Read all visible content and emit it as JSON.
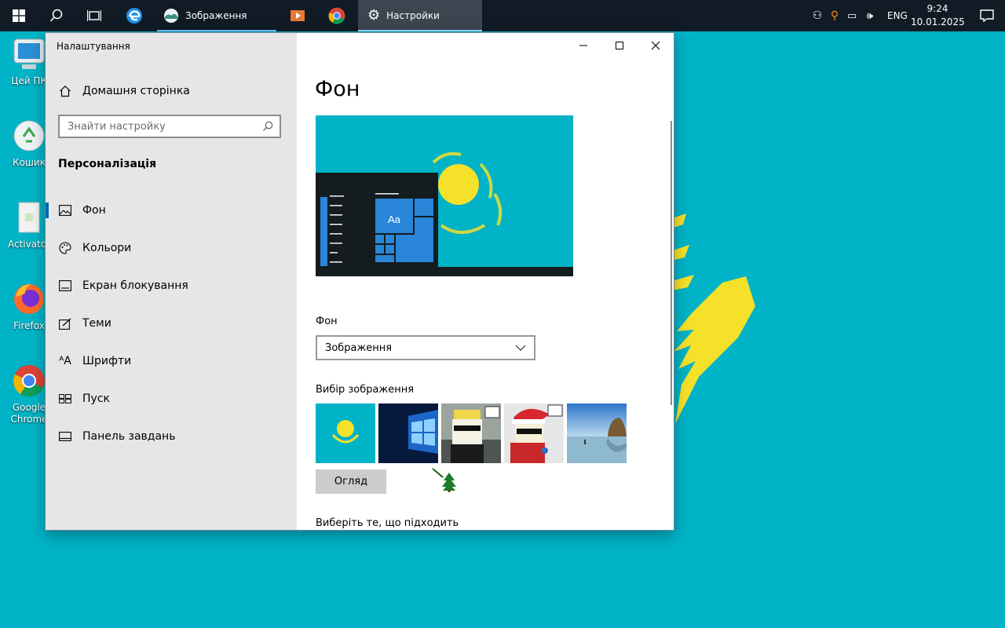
{
  "taskbar": {
    "apps": [
      {
        "name": "photos",
        "label": "Зображення"
      },
      {
        "name": "settings",
        "label": "Настройки"
      }
    ],
    "tray": {
      "language": "ENG",
      "time": "9:24",
      "date": "10.01.2025"
    }
  },
  "desktop": {
    "icons": [
      {
        "label": "Цей ПК",
        "icon": "this-pc-icon"
      },
      {
        "label": "Кошик",
        "icon": "recycle-bin-icon"
      },
      {
        "label": "Activator",
        "icon": "folder-icon"
      },
      {
        "label": "Firefox",
        "icon": "firefox-icon"
      },
      {
        "label": "Google Chrome",
        "icon": "chrome-icon"
      }
    ]
  },
  "window": {
    "title": "Налаштування",
    "home": "Домашня сторінка",
    "search_placeholder": "Знайти настройку",
    "section": "Персоналізація",
    "nav": [
      {
        "label": "Фон",
        "icon": "picture-icon",
        "selected": true
      },
      {
        "label": "Кольори",
        "icon": "palette-icon"
      },
      {
        "label": "Екран блокування",
        "icon": "lock-screen-icon"
      },
      {
        "label": "Теми",
        "icon": "themes-icon"
      },
      {
        "label": "Шрифти",
        "icon": "fonts-icon"
      },
      {
        "label": "Пуск",
        "icon": "start-icon"
      },
      {
        "label": "Панель завдань",
        "icon": "taskbar-icon"
      }
    ]
  },
  "content": {
    "title": "Фон",
    "preview_tile_text": "Aa",
    "background_label": "Фон",
    "background_value": "Зображення",
    "choose_label": "Вибір зображення",
    "browse": "Огляд",
    "fit_label": "Виберіть те, що підходить"
  },
  "colors": {
    "wallpaper": "#00b3c6",
    "sun": "#f5e02a",
    "accent": "#0063b1",
    "taskbar": "#101b26"
  }
}
